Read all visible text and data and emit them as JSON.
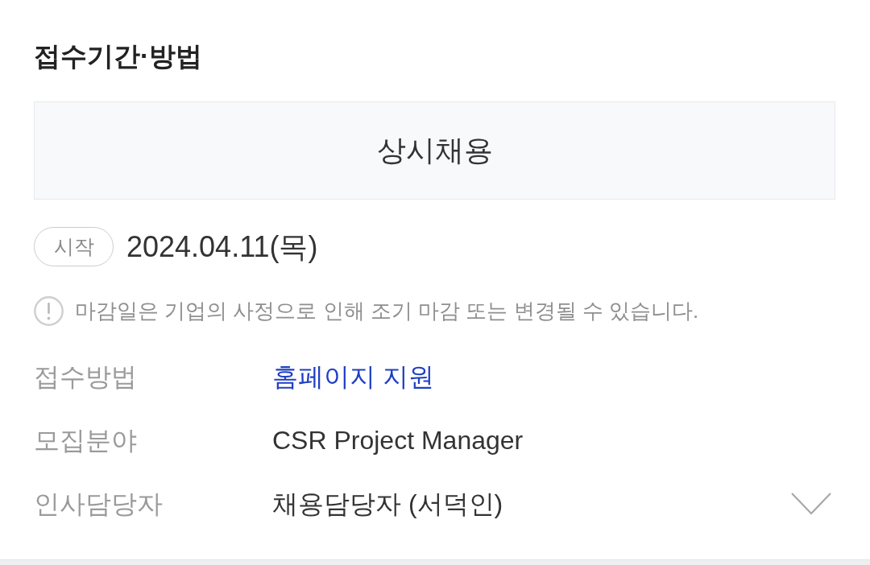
{
  "section": {
    "title": "접수기간·방법"
  },
  "period_box": {
    "text": "상시채용"
  },
  "start": {
    "badge": "시작",
    "date": "2024.04.11(목)"
  },
  "notice": {
    "text": "마감일은 기업의 사정으로 인해 조기 마감 또는 변경될 수 있습니다."
  },
  "details": [
    {
      "label": "접수방법",
      "value": "홈페이지 지원",
      "kind": "link"
    },
    {
      "label": "모집분야",
      "value": "CSR Project Manager",
      "kind": "text"
    },
    {
      "label": "인사담당자",
      "value": "채용담당자 (서덕인)",
      "kind": "text"
    }
  ],
  "expand_toggle": {
    "expanded": false
  }
}
